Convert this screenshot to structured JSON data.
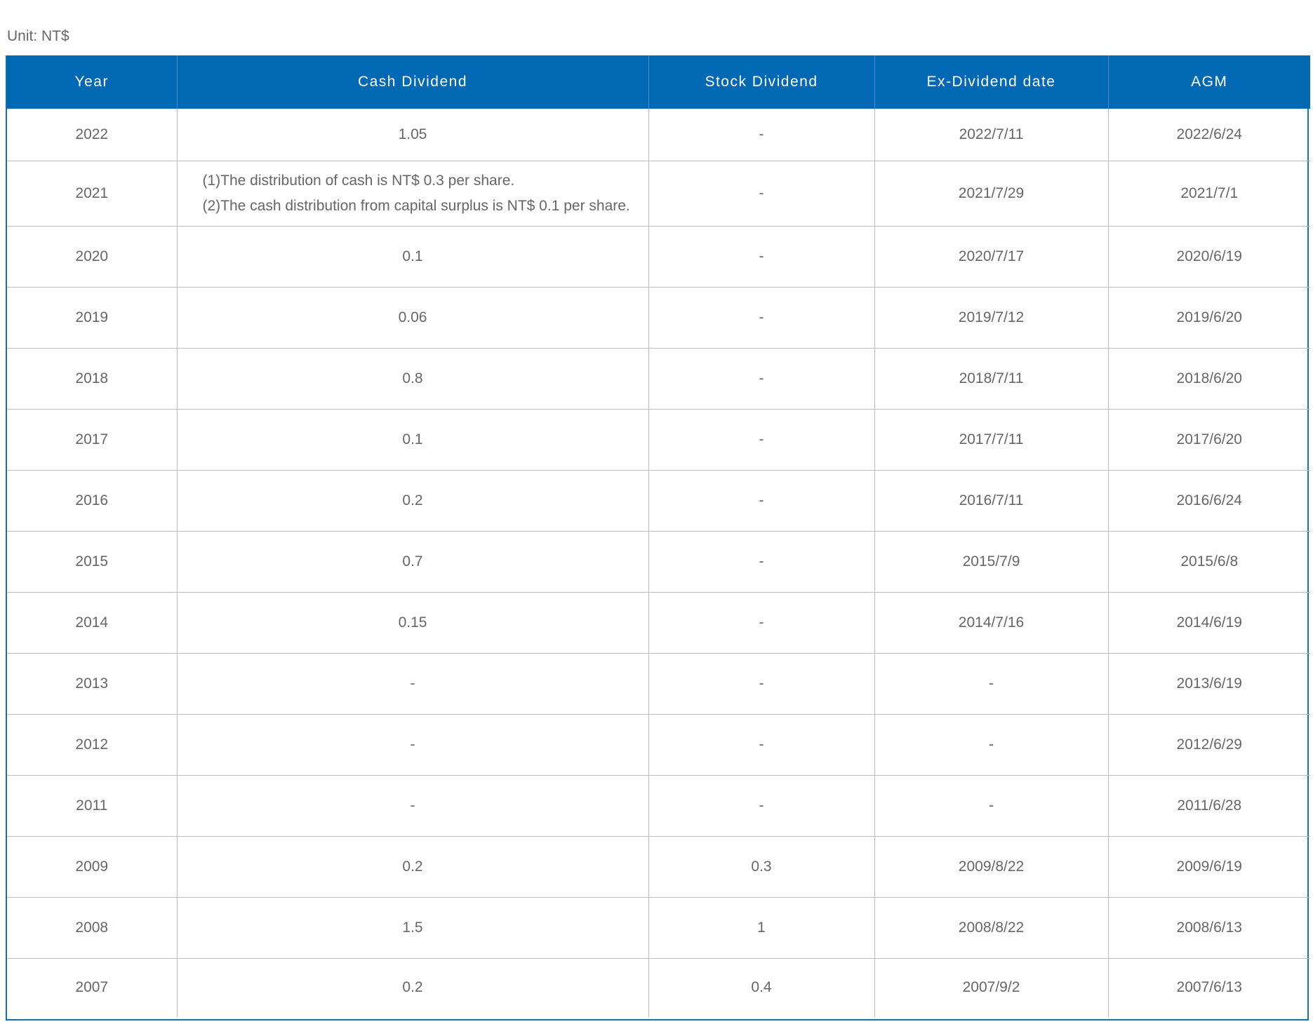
{
  "unit_label": "Unit: NT$",
  "headers": {
    "year": "Year",
    "cash": "Cash Dividend",
    "stock": "Stock Dividend",
    "ex_date": "Ex-Dividend date",
    "agm": "AGM"
  },
  "rows": [
    {
      "year": "2022",
      "cash": "1.05",
      "stock": "-",
      "ex_date": "2022/7/11",
      "agm": "2022/6/24"
    },
    {
      "year": "2021",
      "cash_lines": [
        "(1)The distribution of cash is NT$ 0.3 per share.",
        "(2)The cash distribution from capital surplus is NT$ 0.1 per share."
      ],
      "stock": "-",
      "ex_date": "2021/7/29",
      "agm": "2021/7/1"
    },
    {
      "year": "2020",
      "cash": "0.1",
      "stock": "-",
      "ex_date": "2020/7/17",
      "agm": "2020/6/19"
    },
    {
      "year": "2019",
      "cash": "0.06",
      "stock": "-",
      "ex_date": "2019/7/12",
      "agm": "2019/6/20"
    },
    {
      "year": "2018",
      "cash": "0.8",
      "stock": "-",
      "ex_date": "2018/7/11",
      "agm": "2018/6/20"
    },
    {
      "year": "2017",
      "cash": "0.1",
      "stock": "-",
      "ex_date": "2017/7/11",
      "agm": "2017/6/20"
    },
    {
      "year": "2016",
      "cash": "0.2",
      "stock": "-",
      "ex_date": "2016/7/11",
      "agm": "2016/6/24"
    },
    {
      "year": "2015",
      "cash": "0.7",
      "stock": "-",
      "ex_date": "2015/7/9",
      "agm": "2015/6/8"
    },
    {
      "year": "2014",
      "cash": "0.15",
      "stock": "-",
      "ex_date": "2014/7/16",
      "agm": "2014/6/19"
    },
    {
      "year": "2013",
      "cash": "-",
      "stock": "-",
      "ex_date": "-",
      "agm": "2013/6/19"
    },
    {
      "year": "2012",
      "cash": "-",
      "stock": "-",
      "ex_date": "-",
      "agm": "2012/6/29"
    },
    {
      "year": "2011",
      "cash": "-",
      "stock": "-",
      "ex_date": "-",
      "agm": "2011/6/28"
    },
    {
      "year": "2009",
      "cash": "0.2",
      "stock": "0.3",
      "ex_date": "2009/8/22",
      "agm": "2009/6/19"
    },
    {
      "year": "2008",
      "cash": "1.5",
      "stock": "1",
      "ex_date": "2008/8/22",
      "agm": "2008/6/13"
    },
    {
      "year": "2007",
      "cash": "0.2",
      "stock": "0.4",
      "ex_date": "2007/9/2",
      "agm": "2007/6/13"
    }
  ]
}
